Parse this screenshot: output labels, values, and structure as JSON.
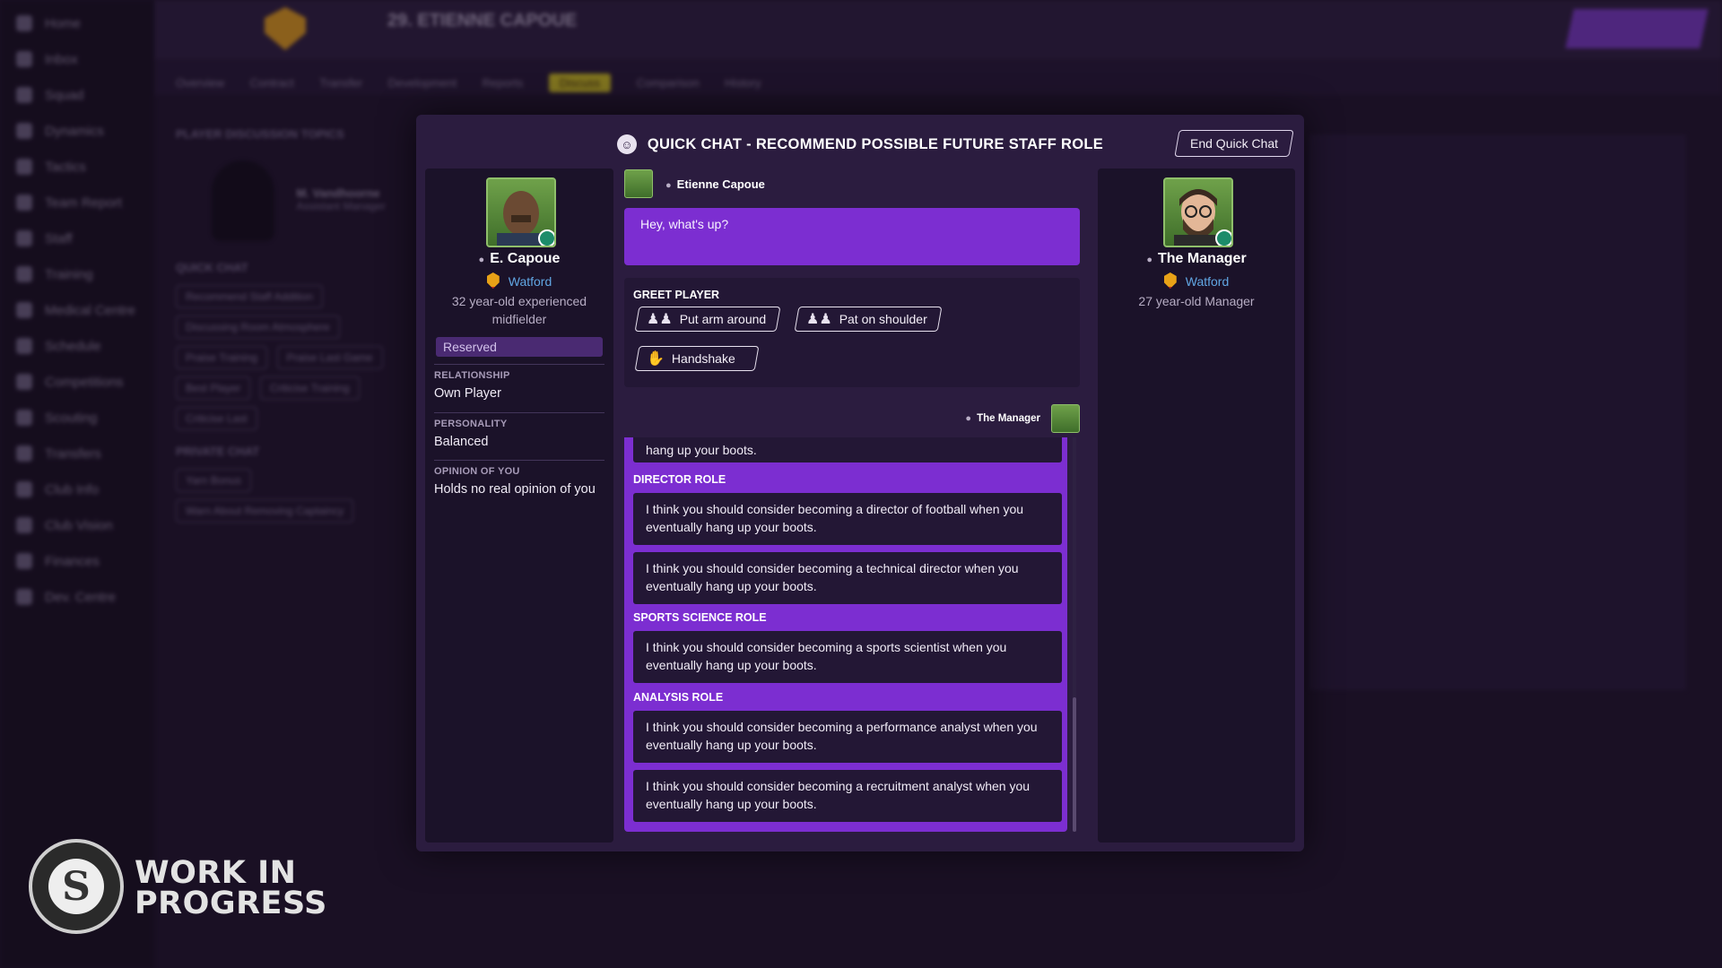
{
  "background": {
    "sidebar": [
      "Home",
      "Inbox",
      "Squad",
      "Dynamics",
      "Tactics",
      "Team Report",
      "Staff",
      "Training",
      "Medical Centre",
      "Schedule",
      "Competitions",
      "Scouting",
      "Transfers",
      "Club Info",
      "Club Vision",
      "Finances",
      "Dev. Centre"
    ],
    "player_header": "29. ETIENNE CAPOUE",
    "tabs": [
      "Overview",
      "Contract",
      "Transfer",
      "Development",
      "Reports",
      "Discuss",
      "Comparison",
      "History"
    ],
    "active_tab": "Discuss",
    "panel_title": "PLAYER DISCUSSION TOPICS",
    "panel_person": "M. Vandhoorne",
    "panel_role": "Assistant Manager",
    "quick_chat_h": "QUICK CHAT",
    "pills": [
      "Recommend Staff Addition",
      "Discussing Room Atmosphere",
      "Praise Training",
      "Praise Last Game",
      "Best Player",
      "Criticise Training",
      "Criticise Last"
    ],
    "private_chat_h": "PRIVATE CHAT",
    "private_pills": [
      "Yarn Bonus",
      "Warn About Removing Captaincy"
    ]
  },
  "logo": {
    "text_line1": "WORK IN",
    "text_line2": "PROGRESS"
  },
  "modal": {
    "title": "QUICK CHAT - RECOMMEND POSSIBLE FUTURE STAFF ROLE",
    "end_button": "End Quick Chat",
    "player": {
      "name": "E. Capoue",
      "club": "Watford",
      "description": "32 year-old experienced midfielder",
      "status": "Reserved",
      "relationship_label": "RELATIONSHIP",
      "relationship": "Own Player",
      "personality_label": "PERSONALITY",
      "personality": "Balanced",
      "opinion_label": "OPINION OF YOU",
      "opinion": "Holds no real opinion of you"
    },
    "manager": {
      "name": "The Manager",
      "club": "Watford",
      "description": "27 year-old Manager"
    },
    "chat": {
      "speaker": "Etienne Capoue",
      "message": "Hey, what's up?",
      "greet_heading": "GREET PLAYER",
      "greet_options": [
        "Put arm around",
        "Pat on shoulder",
        "Handshake"
      ],
      "reply_speaker": "The Manager",
      "partial_option_tail": "hang up your boots.",
      "sections": [
        {
          "heading": "DIRECTOR ROLE",
          "options": [
            "I think you should consider becoming a director of football when you eventually hang up your boots.",
            "I think you should consider becoming a technical director when you eventually hang up your boots."
          ]
        },
        {
          "heading": "SPORTS SCIENCE ROLE",
          "options": [
            "I think you should consider becoming a sports scientist when you eventually hang up your boots."
          ]
        },
        {
          "heading": "ANALYSIS ROLE",
          "options": [
            "I think you should consider becoming a performance analyst when you eventually hang up your boots.",
            "I think you should consider becoming a recruitment analyst when you eventually hang up your boots."
          ]
        }
      ]
    }
  }
}
